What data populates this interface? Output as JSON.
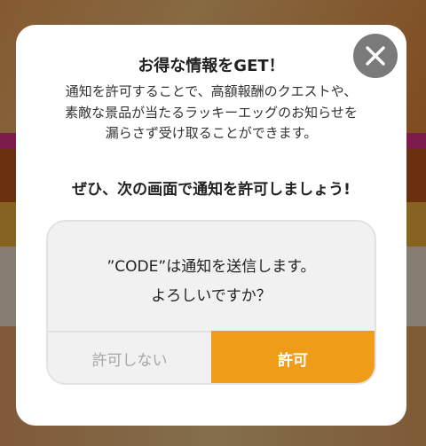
{
  "dialog": {
    "title": "お得な情報をGET！",
    "description_lines": [
      "通知を許可することで、高額報酬のクエストや、",
      "素敵な景品が当たるラッキーエッグのお知らせを",
      "漏らさず受け取ることができます。"
    ],
    "cta": "ぜひ、次の画面で通知を許可しましょう!",
    "close_icon": "close-icon"
  },
  "mock_alert": {
    "message_line1": "”CODE”は通知を送信します。",
    "message_line2": "よろしいですか？",
    "deny_label": "許可しない",
    "allow_label": "許可"
  },
  "colors": {
    "allow": "#ef9c18",
    "close_bg": "#7a7a7a"
  }
}
